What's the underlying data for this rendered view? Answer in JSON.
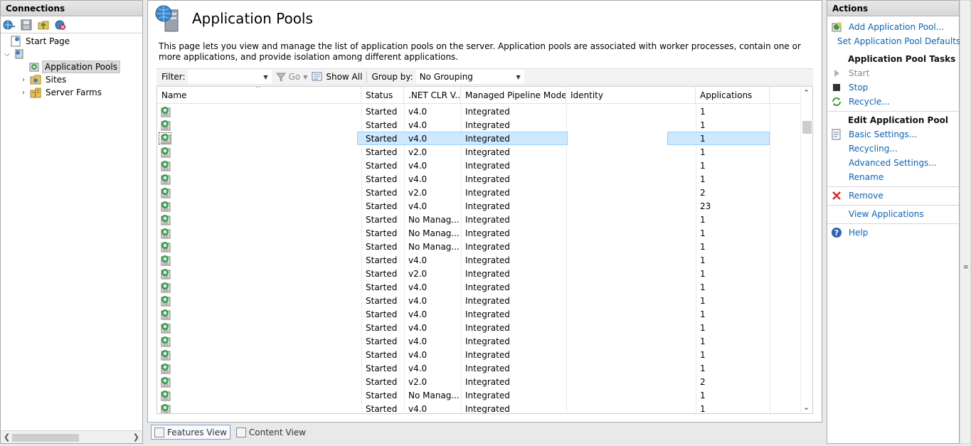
{
  "connections": {
    "title": "Connections",
    "toolbar": [
      {
        "icon": "globe-connect-icon"
      },
      {
        "icon": "save-icon"
      },
      {
        "icon": "up-folder-icon"
      },
      {
        "icon": "disconnect-icon"
      }
    ],
    "tree": {
      "start_page": "Start Page",
      "server": "",
      "app_pools": "Application Pools",
      "sites": "Sites",
      "server_farms": "Server Farms"
    }
  },
  "page": {
    "title": "Application Pools",
    "description": "This page lets you view and manage the list of application pools on the server. Application pools are associated with worker processes, contain one or more applications, and provide isolation among different applications."
  },
  "filterbar": {
    "filter_label": "Filter:",
    "filter_value": "",
    "go_label": "Go",
    "show_all_label": "Show All",
    "group_by_label": "Group by:",
    "group_by_value": "No Grouping"
  },
  "grid": {
    "columns": [
      "Name",
      "Status",
      ".NET CLR V...",
      "Managed Pipeline Mode",
      "Identity",
      "Applications"
    ],
    "selected_index": 2,
    "rows": [
      {
        "name": "",
        "status": "Started",
        "clr": "v4.0",
        "pipeline": "Integrated",
        "identity": "",
        "apps": "1"
      },
      {
        "name": "",
        "status": "Started",
        "clr": "v4.0",
        "pipeline": "Integrated",
        "identity": "",
        "apps": "1"
      },
      {
        "name": "",
        "status": "Started",
        "clr": "v4.0",
        "pipeline": "Integrated",
        "identity": "",
        "apps": "1"
      },
      {
        "name": "",
        "status": "Started",
        "clr": "v2.0",
        "pipeline": "Integrated",
        "identity": "",
        "apps": "1"
      },
      {
        "name": "",
        "status": "Started",
        "clr": "v4.0",
        "pipeline": "Integrated",
        "identity": "",
        "apps": "1"
      },
      {
        "name": "",
        "status": "Started",
        "clr": "v4.0",
        "pipeline": "Integrated",
        "identity": "",
        "apps": "1"
      },
      {
        "name": "",
        "status": "Started",
        "clr": "v2.0",
        "pipeline": "Integrated",
        "identity": "",
        "apps": "2"
      },
      {
        "name": "",
        "status": "Started",
        "clr": "v4.0",
        "pipeline": "Integrated",
        "identity": "",
        "apps": "23"
      },
      {
        "name": "",
        "status": "Started",
        "clr": "No Manag...",
        "pipeline": "Integrated",
        "identity": "",
        "apps": "1"
      },
      {
        "name": "",
        "status": "Started",
        "clr": "No Manag...",
        "pipeline": "Integrated",
        "identity": "",
        "apps": "1"
      },
      {
        "name": "",
        "status": "Started",
        "clr": "No Manag...",
        "pipeline": "Integrated",
        "identity": "",
        "apps": "1"
      },
      {
        "name": "",
        "status": "Started",
        "clr": "v4.0",
        "pipeline": "Integrated",
        "identity": "",
        "apps": "1"
      },
      {
        "name": "",
        "status": "Started",
        "clr": "v2.0",
        "pipeline": "Integrated",
        "identity": "",
        "apps": "1"
      },
      {
        "name": "",
        "status": "Started",
        "clr": "v4.0",
        "pipeline": "Integrated",
        "identity": "",
        "apps": "1"
      },
      {
        "name": "",
        "status": "Started",
        "clr": "v4.0",
        "pipeline": "Integrated",
        "identity": "",
        "apps": "1"
      },
      {
        "name": "",
        "status": "Started",
        "clr": "v4.0",
        "pipeline": "Integrated",
        "identity": "",
        "apps": "1"
      },
      {
        "name": "",
        "status": "Started",
        "clr": "v4.0",
        "pipeline": "Integrated",
        "identity": "",
        "apps": "1"
      },
      {
        "name": "",
        "status": "Started",
        "clr": "v4.0",
        "pipeline": "Integrated",
        "identity": "",
        "apps": "1"
      },
      {
        "name": "",
        "status": "Started",
        "clr": "v4.0",
        "pipeline": "Integrated",
        "identity": "",
        "apps": "1"
      },
      {
        "name": "",
        "status": "Started",
        "clr": "v4.0",
        "pipeline": "Integrated",
        "identity": "",
        "apps": "1"
      },
      {
        "name": "",
        "status": "Started",
        "clr": "v2.0",
        "pipeline": "Integrated",
        "identity": "",
        "apps": "2"
      },
      {
        "name": "",
        "status": "Started",
        "clr": "No Manag...",
        "pipeline": "Integrated",
        "identity": "",
        "apps": "1"
      },
      {
        "name": "",
        "status": "Started",
        "clr": "v4.0",
        "pipeline": "Integrated",
        "identity": "",
        "apps": "1"
      }
    ]
  },
  "tabs": {
    "features_view": "Features View",
    "content_view": "Content View"
  },
  "actions": {
    "title": "Actions",
    "add_pool": "Add Application Pool...",
    "set_defaults": "Set Application Pool Defaults...",
    "tasks_header": "Application Pool Tasks",
    "start": "Start",
    "stop": "Stop",
    "recycle": "Recycle...",
    "edit_header": "Edit Application Pool",
    "basic_settings": "Basic Settings...",
    "recycling": "Recycling...",
    "advanced_settings": "Advanced Settings...",
    "rename": "Rename",
    "remove": "Remove",
    "view_applications": "View Applications",
    "help": "Help"
  },
  "colors": {
    "link": "#0b64b5",
    "selection": "#cde8ff",
    "remove_red": "#d9262c",
    "stop_dark": "#333333",
    "recycle_green": "#3a9c3a",
    "help_blue": "#2a63b8"
  }
}
